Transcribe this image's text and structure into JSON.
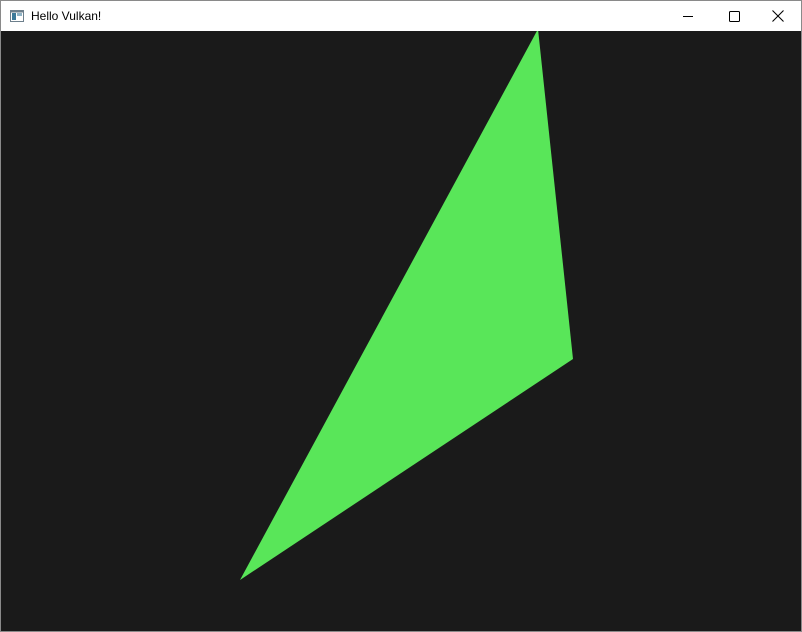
{
  "window": {
    "title": "Hello Vulkan!",
    "icon": "window-app-icon",
    "background_color": "#1a1a1a"
  },
  "caption_buttons": {
    "minimize_icon": "minimize-icon",
    "maximize_icon": "maximize-icon",
    "close_icon": "close-icon"
  },
  "scene": {
    "shape": "triangle",
    "fill_color": "#59e659"
  }
}
